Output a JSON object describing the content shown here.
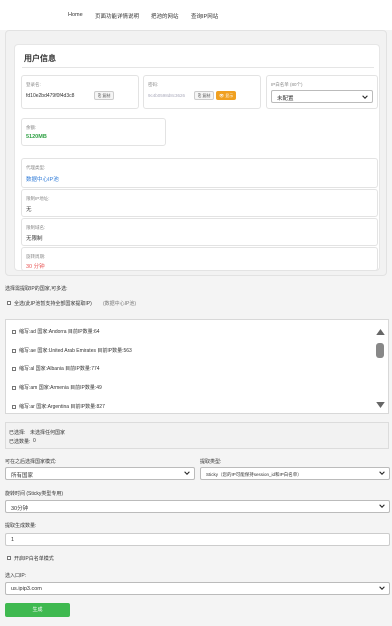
{
  "nav": {
    "items": [
      "Home",
      "页面功能详情说明",
      "把池的网站",
      "查询IP网站"
    ]
  },
  "user_info": {
    "title": "用户信息",
    "username": {
      "label": "登录名:",
      "value": "fd10e2bd479f0f4d3c8",
      "copy_label": "复制"
    },
    "password": {
      "label": "密码:",
      "value": "9c4b0598d8c3626",
      "copy_label": "复制",
      "show_label": "显示"
    },
    "ip_whitelist": {
      "label": "IP白名单 (80个)",
      "value": "未配置"
    },
    "balance": {
      "label": "余额:",
      "value": "5120MB"
    },
    "proxy_type": {
      "label": "代理类型:",
      "value": "数据中心IP池"
    },
    "limited_ips": {
      "label": "限制IP地址:",
      "value": "无"
    },
    "limited_domains": {
      "label": "限制域名:",
      "value": "无限制"
    },
    "rotation": {
      "label": "旋转周期:",
      "value": "30 分钟"
    }
  },
  "country_section": {
    "title": "选择需提取IP的国家,可多选:",
    "select_all_label": "全选(此IP池暂支持全部国家提取IP)",
    "select_all_hint": "(数据中心IP池)",
    "countries": [
      "缩写:ad 国家:Andorra 目前IP数量:64",
      "缩写:ae 国家:United Arab Emirates 目前IP数量:563",
      "缩写:al 国家:Albania 目前IP数量:774",
      "缩写:am 国家:Armenia 目前IP数量:49",
      "缩写:ar 国家:Argentina 目前IP数量:827"
    ]
  },
  "selection_status": {
    "selected_label": "已选择:",
    "selected_value": "未选择任何国家",
    "count_label": "已选数量:",
    "count_value": "0"
  },
  "form": {
    "mode_label": "可在之后选择国家模式:",
    "mode_value": "所有国家",
    "extract_type_label": "提取类型:",
    "extract_type_value": "Sticky（您的IP可能保持session_id和IP白名单）",
    "rotation_label": "旋转时间 (Sticky类型专用)",
    "rotation_value": "30分钟",
    "quantity_label": "提取生成数量:",
    "quantity_value": "1",
    "whitelist_mode_label": "开启IP白名单模式",
    "entry_label": "选入口IP:",
    "entry_value": "us.ipip3.com",
    "generate_label": "生成"
  }
}
